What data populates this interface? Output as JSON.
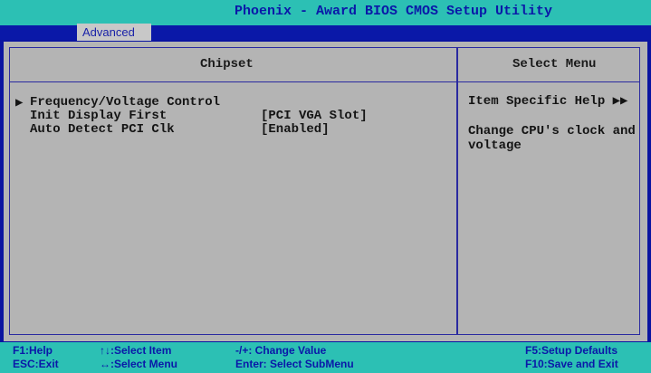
{
  "header": {
    "title": "Phoenix - Award BIOS CMOS Setup Utility",
    "active_tab": "Advanced"
  },
  "left_panel": {
    "heading": "Chipset",
    "items": [
      {
        "label": "Frequency/Voltage Control",
        "value": "",
        "submenu": true,
        "marker": "▶"
      },
      {
        "label": "Init Display First",
        "value": "[PCI VGA Slot]",
        "submenu": false,
        "marker": ""
      },
      {
        "label": "Auto Detect PCI Clk",
        "value": "[Enabled]",
        "submenu": false,
        "marker": ""
      }
    ]
  },
  "right_panel": {
    "heading": "Select Menu",
    "help_title": "Item Specific Help ▶▶",
    "help_text": "Change CPU's clock and voltage"
  },
  "footer": {
    "f1": "F1:Help",
    "esc": "ESC:Exit",
    "select_item": "↑↓:Select Item",
    "select_menu": "↔:Select Menu",
    "change_value": "-/+: Change Value",
    "enter": "Enter: Select SubMenu",
    "f5": "F5:Setup Defaults",
    "f10": "F10:Save and Exit"
  },
  "colors": {
    "background": "#0a14a0",
    "title_bar": "#2cc0b4",
    "panel": "#b4b4b4",
    "text_accent": "#0a18a8"
  }
}
